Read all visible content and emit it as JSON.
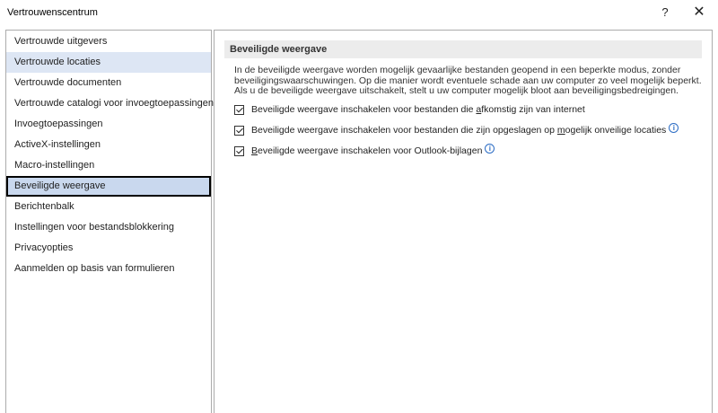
{
  "window": {
    "title": "Vertrouwenscentrum",
    "help_label": "?",
    "close_label": "✕"
  },
  "nav": {
    "items": [
      {
        "label": "Vertrouwde uitgevers"
      },
      {
        "label": "Vertrouwde locaties"
      },
      {
        "label": "Vertrouwde documenten"
      },
      {
        "label": "Vertrouwde catalogi voor invoegtoepassingen"
      },
      {
        "label": "Invoegtoepassingen"
      },
      {
        "label": "ActiveX-instellingen"
      },
      {
        "label": "Macro-instellingen"
      },
      {
        "label": "Beveiligde weergave"
      },
      {
        "label": "Berichtenbalk"
      },
      {
        "label": "Instellingen voor bestandsblokkering"
      },
      {
        "label": "Privacyopties"
      },
      {
        "label": "Aanmelden op basis van formulieren"
      }
    ],
    "hover_index": 1,
    "selected_index": 7
  },
  "main": {
    "section_title": "Beveiligde weergave",
    "description": [
      "In de beveiligde weergave worden mogelijk gevaarlijke bestanden geopend in een beperkte modus, zonder",
      "beveiligingswaarschuwingen. Op die manier wordt eventuele schade aan uw computer zo veel mogelijk beperkt.",
      "Als u de beveiligde weergave uitschakelt, stelt u uw computer mogelijk bloot aan beveiligingsbedreigingen."
    ],
    "options": [
      {
        "pre": "Beveiligde weergave inschakelen voor bestanden die ",
        "ul": "a",
        "post": "fkomstig zijn van internet",
        "checked": true,
        "info": false
      },
      {
        "pre": "Beveiligde weergave inschakelen voor bestanden die zijn opgeslagen op ",
        "ul": "m",
        "post": "ogelijk onveilige locaties",
        "checked": true,
        "info": true
      },
      {
        "pre": "",
        "ul": "B",
        "post": "eveiligde weergave inschakelen voor Outlook-bijlagen",
        "checked": true,
        "info": true
      }
    ],
    "info_glyph": "i"
  }
}
